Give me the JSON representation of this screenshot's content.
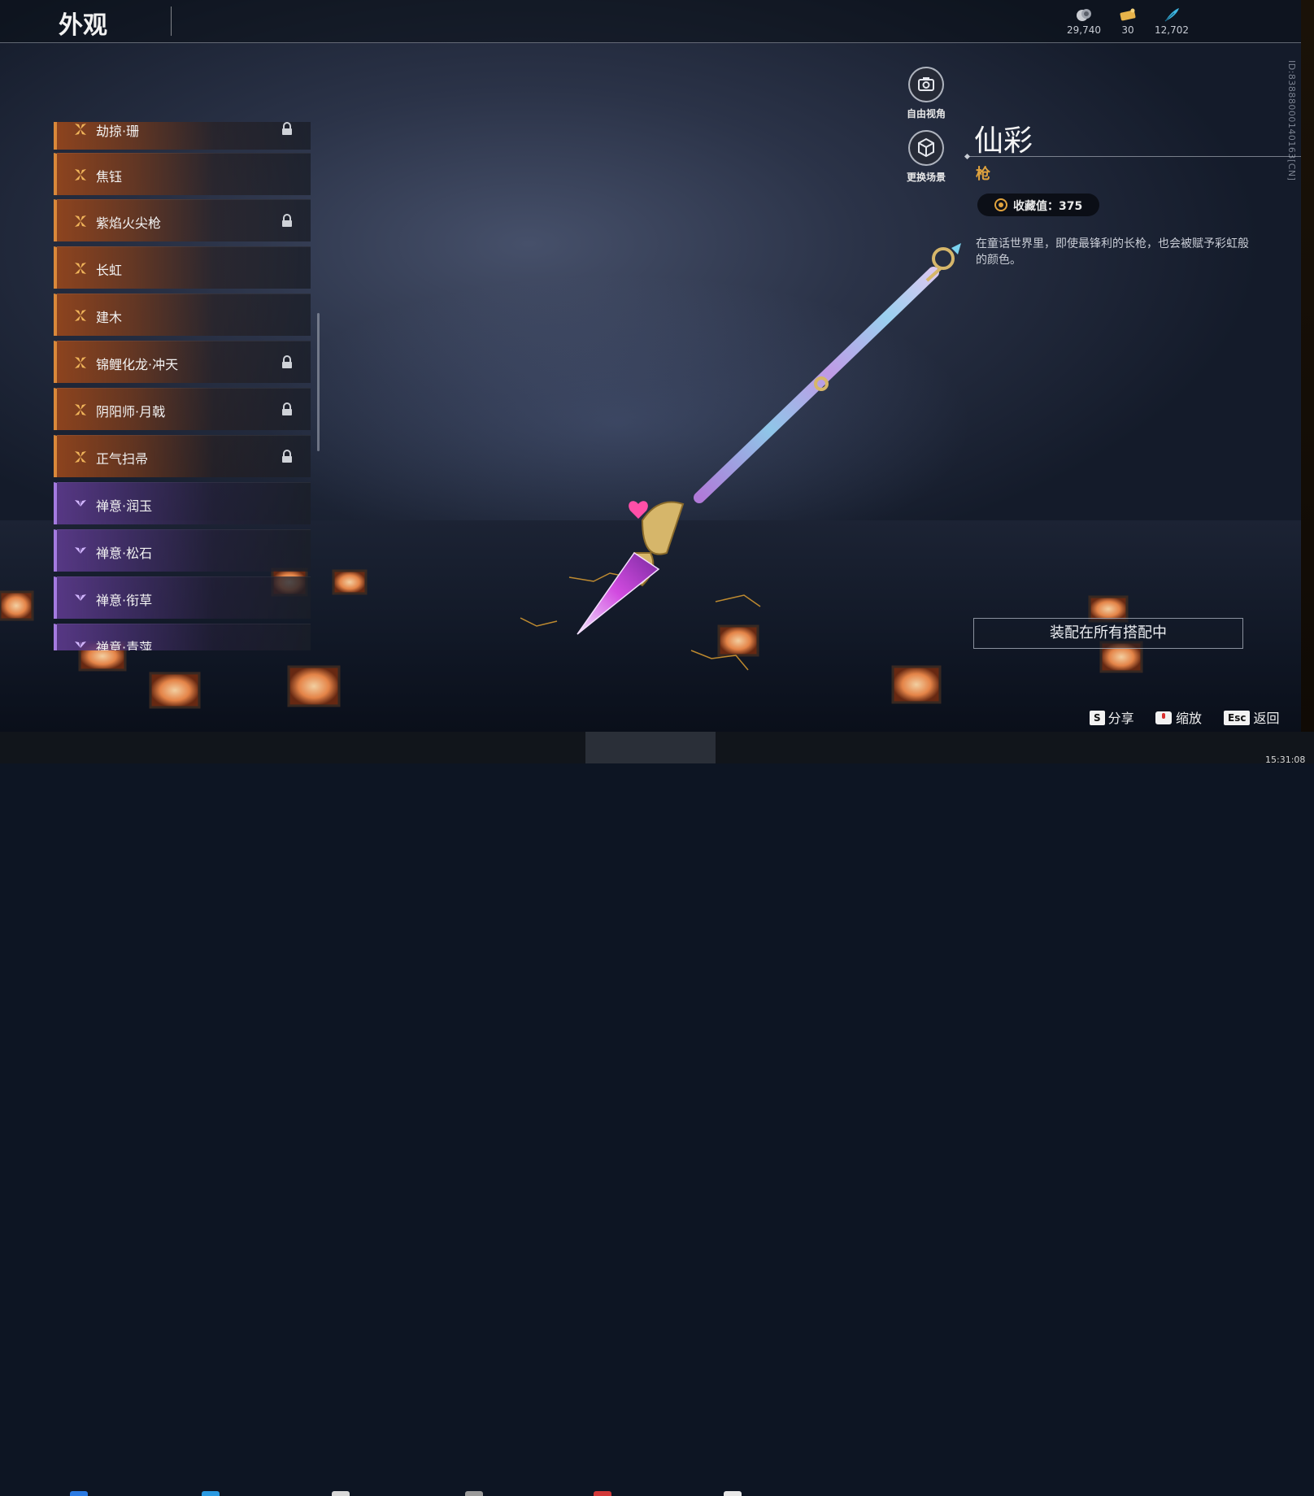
{
  "header": {
    "title": "外观",
    "currencies": [
      {
        "icon": "coin-icon",
        "value": "29,740"
      },
      {
        "icon": "ticket-icon",
        "value": "30"
      },
      {
        "icon": "feather-icon",
        "value": "12,702"
      }
    ],
    "player_id": "ID:83888000140163[CN]"
  },
  "list": {
    "items": [
      {
        "label": "劫掠·珊",
        "rarity": "orange",
        "locked": true
      },
      {
        "label": "焦钰",
        "rarity": "orange",
        "locked": false
      },
      {
        "label": "紫焰火尖枪",
        "rarity": "orange",
        "locked": true
      },
      {
        "label": "长虹",
        "rarity": "orange",
        "locked": false
      },
      {
        "label": "建木",
        "rarity": "orange",
        "locked": false
      },
      {
        "label": "锦鲤化龙·冲天",
        "rarity": "orange",
        "locked": true
      },
      {
        "label": "阴阳师·月戟",
        "rarity": "orange",
        "locked": true
      },
      {
        "label": "正气扫帚",
        "rarity": "orange",
        "locked": true
      },
      {
        "label": "禅意·润玉",
        "rarity": "purple",
        "locked": false
      },
      {
        "label": "禅意·松石",
        "rarity": "purple",
        "locked": false
      },
      {
        "label": "禅意·衔草",
        "rarity": "purple",
        "locked": false
      },
      {
        "label": "禅意·青萍",
        "rarity": "purple",
        "locked": false
      }
    ]
  },
  "tools": {
    "free_view": "自由视角",
    "change_scene": "更换场景"
  },
  "item": {
    "name": "仙彩",
    "type": "枪",
    "collect_label": "收藏值：375",
    "description": "在童话世界里，即使最锋利的长枪，也会被赋予彩虹般的颜色。",
    "equip_button": "装配在所有搭配中"
  },
  "hints": {
    "share_key": "S",
    "share_label": "分享",
    "zoom_label": "缩放",
    "back_key": "Esc",
    "back_label": "返回"
  },
  "taskbar": {
    "clock": "15:31:08"
  },
  "colors": {
    "orange_rarity": "#d9883a",
    "purple_rarity": "#a47ae0",
    "type_gold": "#e0a33e"
  }
}
